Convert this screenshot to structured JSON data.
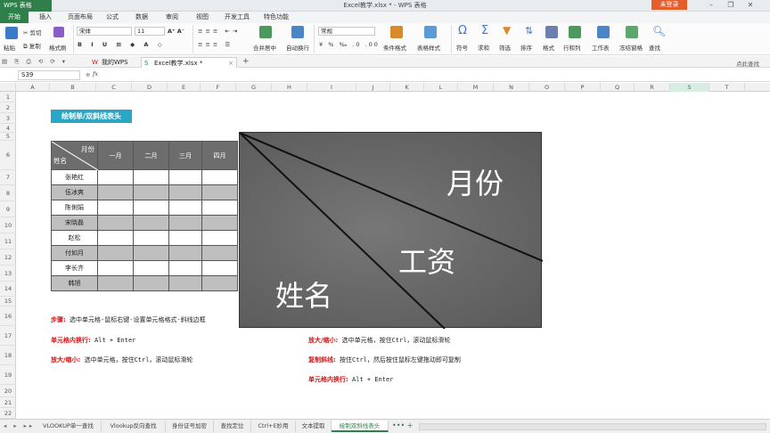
{
  "app": {
    "name": "WPS 表格",
    "window_title": "Excel教学.xlsx * - WPS 表格",
    "login": "未登录"
  },
  "menu": [
    "开始",
    "插入",
    "页面布局",
    "公式",
    "数据",
    "审阅",
    "视图",
    "开发工具",
    "特色功能"
  ],
  "ribbon": {
    "paste": "粘贴",
    "cut": "剪切",
    "copy": "复制",
    "format_painter": "格式刷",
    "font": "宋体",
    "size": "11",
    "merge": "合并居中",
    "wrap": "自动换行",
    "number_format": "常规",
    "cond_format": "条件格式",
    "table_style": "表格样式",
    "symbol": "符号",
    "sum": "求和",
    "filter": "筛选",
    "sort": "排序",
    "format": "格式",
    "rowcol": "行和列",
    "sheet": "工作表",
    "freeze": "冻结窗格",
    "find": "查找"
  },
  "doc_tabs": {
    "home": "我的WPS",
    "file": "Excel教学.xlsx *",
    "right": "点此查找"
  },
  "formula": {
    "cell": "S39",
    "fx": "fx",
    "value": ""
  },
  "columns": [
    "A",
    "B",
    "C",
    "D",
    "E",
    "F",
    "G",
    "H",
    "I",
    "J",
    "K",
    "L",
    "M",
    "N",
    "O",
    "P",
    "Q",
    "R",
    "S",
    "T"
  ],
  "rows": [
    "1",
    "2",
    "3",
    "4",
    "5",
    "6",
    "7",
    "8",
    "9",
    "10",
    "11",
    "12",
    "13",
    "14",
    "15",
    "16",
    "17",
    "18",
    "19",
    "20",
    "21",
    "22"
  ],
  "sheet_title": "绘制单/双斜线表头",
  "table": {
    "corner_top": "月份",
    "corner_bottom": "姓名",
    "months": [
      "一月",
      "二月",
      "三月",
      "四月"
    ],
    "names": [
      "张艳红",
      "伍冰爽",
      "陈俐娟",
      "宋晓磊",
      "赵松",
      "付如月",
      "李长齐",
      "韩旭"
    ]
  },
  "bigbox": {
    "month": "月份",
    "salary": "工资",
    "name": "姓名"
  },
  "notes_left": [
    {
      "label": "步骤:",
      "text": "选中单元格-鼠标右键-设置单元格格式-斜线边框"
    },
    {
      "label": "单元格内换行:",
      "text": "Alt + Enter"
    },
    {
      "label": "放大/缩小:",
      "text": "选中单元格，按住Ctrl，滚动鼠标滑轮"
    }
  ],
  "notes_right": [
    {
      "label": "放大/缩小:",
      "text": "选中单元格，按住Ctrl，滚动鼠标滑轮"
    },
    {
      "label": "复制斜线:",
      "text": "按住Ctrl，然后按住鼠标左键拖动即可复制"
    },
    {
      "label": "单元格内换行:",
      "text": "Alt + Enter"
    }
  ],
  "sheet_tabs": [
    "VLOOKUP单一查找",
    "Vlookup反向查找",
    "身份证号加密",
    "查找定位",
    "Ctrl+E妙用",
    "文本提取",
    "绘制双斜线表头"
  ],
  "active_sheet": "绘制双斜线表头"
}
